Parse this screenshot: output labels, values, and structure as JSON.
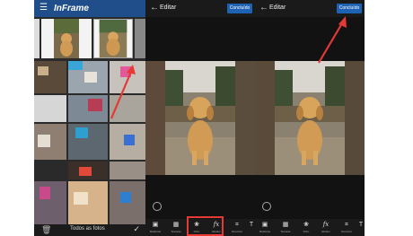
{
  "gallery": {
    "app_title": "InFrame",
    "footer_label": "Todos as fotos",
    "icons": [
      "menu-icon",
      "trash-icon",
      "check-icon"
    ]
  },
  "editor_left": {
    "title": "Editar",
    "done_label": "Concluído",
    "tools": [
      {
        "label": "Molduras",
        "icon": "frame-icon"
      },
      {
        "label": "Texturas",
        "icon": "texture-icon"
      },
      {
        "label": "Filtro",
        "icon": "filter-icon"
      },
      {
        "label": "Efeitos",
        "icon": "effects-icon"
      },
      {
        "label": "Recortar",
        "icon": "crop-icon"
      }
    ]
  },
  "editor_right": {
    "title": "Editar",
    "done_label": "Concluído",
    "tools": [
      {
        "label": "Molduras",
        "icon": "frame-icon"
      },
      {
        "label": "Texturas",
        "icon": "texture-icon"
      },
      {
        "label": "Filtro",
        "icon": "filter-icon"
      },
      {
        "label": "Efeitos",
        "icon": "effects-icon"
      },
      {
        "label": "Recortar",
        "icon": "crop-icon"
      }
    ]
  },
  "colors": {
    "header_blue": "#1f4e8a",
    "done_blue": "#1e63b3",
    "highlight_red": "#e53935",
    "arrow_red": "#e53935"
  }
}
